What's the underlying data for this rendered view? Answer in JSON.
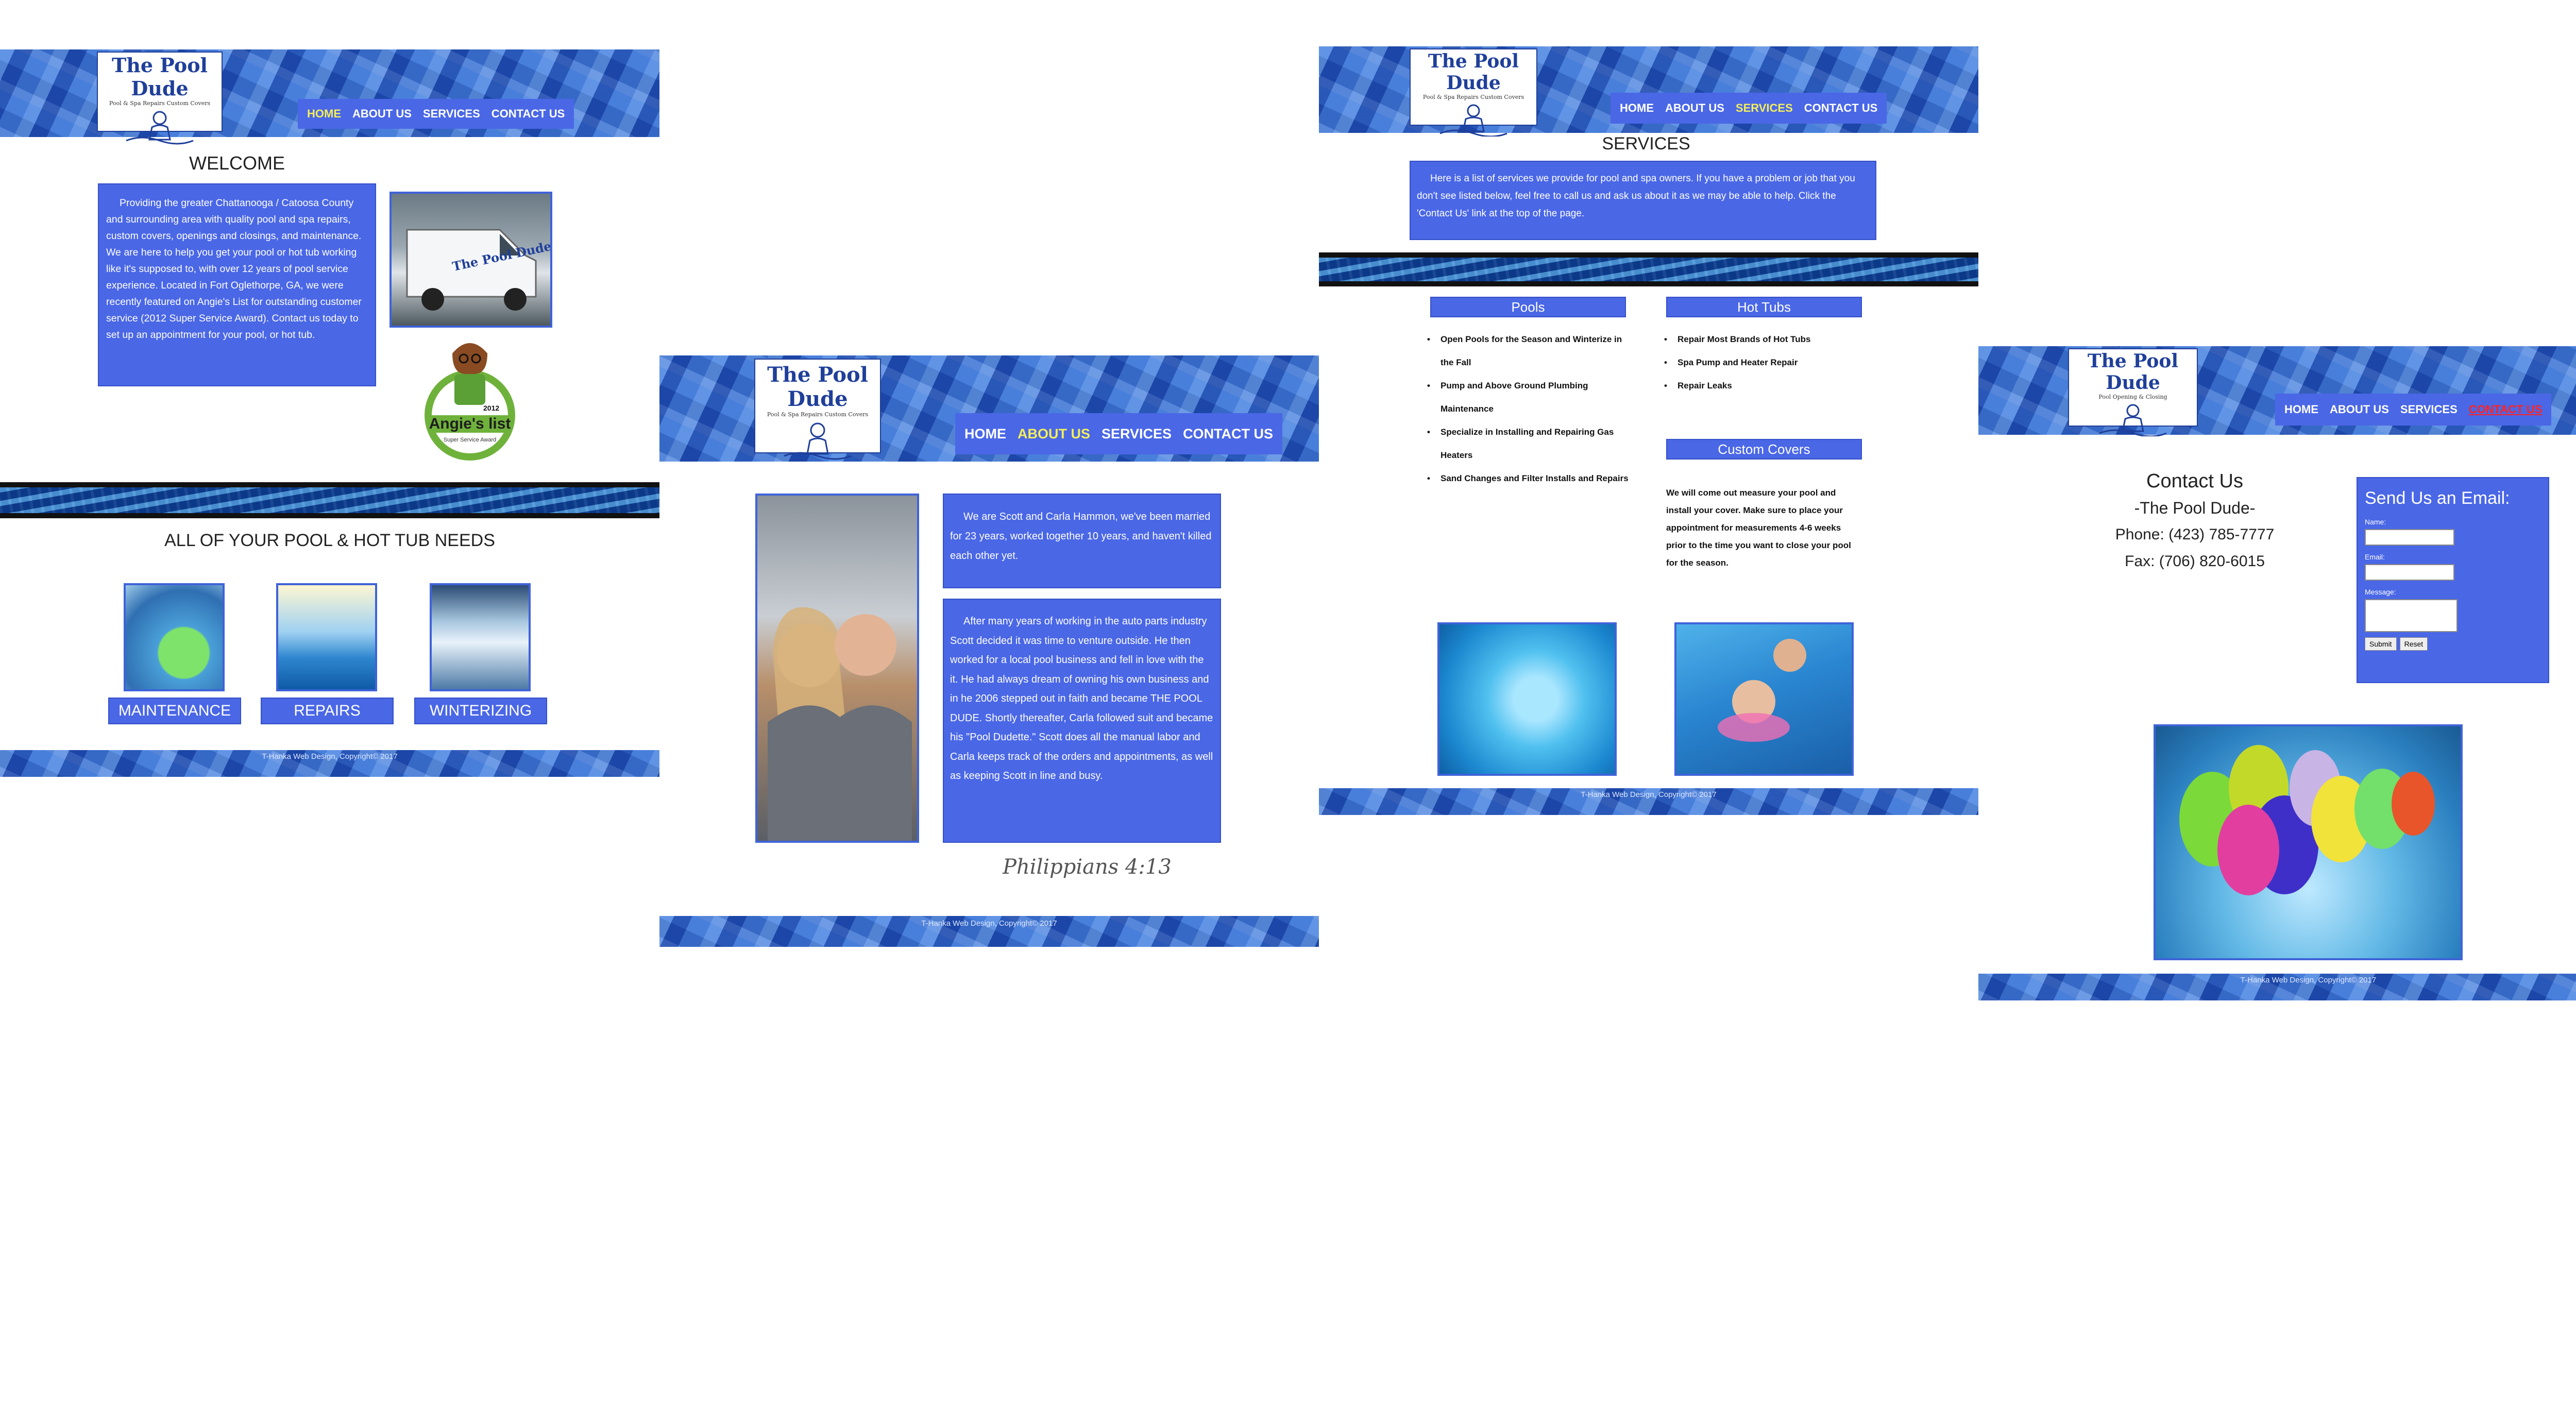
{
  "site": {
    "logo_title": "The Pool Dude",
    "logo_sub_left": "Pool & Spa Repairs Custom Covers",
    "logo_sub_right": "Pool Opening & Closing",
    "footer_text": "T-Hanka Web Design, Copyright© 2017",
    "nav": [
      "HOME",
      "ABOUT US",
      "SERVICES",
      "CONTACT US"
    ]
  },
  "home": {
    "welcome_heading": "WELCOME",
    "intro_text": "Providing the greater Chattanooga / Catoosa County and surrounding area with quality pool and spa repairs, custom covers, openings and closings, and maintenance. We are here to help you get your pool or hot tub working like it's supposed to, with over 12 years of pool service experience. Located in Fort Oglethorpe, GA, we were recently featured on Angie's List for outstanding customer service (2012 Super Service Award). Contact us today to set up an appointment for your pool, or hot tub.",
    "badge_text": "Angie's list",
    "badge_year": "2012",
    "badge_sub": "Super Service Award",
    "needs_heading": "ALL OF YOUR POOL & HOT TUB NEEDS",
    "tiles": [
      "MAINTENANCE",
      "REPAIRS",
      "WINTERIZING"
    ]
  },
  "about": {
    "para1": "We are Scott and Carla Hammon, we've been married for 23 years, worked together 10 years, and haven't killed each other yet.",
    "para2": "After many years of working in the auto parts industry Scott decided it was time to venture outside. He then worked for a local pool business and fell in love with the it. He had always dream of owning his own business and in he 2006 stepped out in faith and became THE POOL DUDE. Shortly thereafter, Carla followed suit and became his \"Pool Dudette.\" Scott does all the manual labor and Carla keeps track of the orders and appointments, as well as keeping Scott in line and busy.",
    "verse": "Philippians 4:13"
  },
  "services": {
    "heading": "SERVICES",
    "intro": "Here is a list of services we provide for pool and spa owners. If you have a problem or job that you don't see listed below, feel free to call us and ask us about it as we may be able to help. Click the 'Contact Us' link at the top of the page.",
    "pools_title": "Pools",
    "pools_items": [
      "Open Pools for the Season and Winterize in the Fall",
      "Pump and Above Ground Plumbing Maintenance",
      "Specialize in Installing and Repairing Gas Heaters",
      "Sand Changes and Filter Installs and Repairs"
    ],
    "hottubs_title": "Hot Tubs",
    "hottubs_items": [
      "Repair Most Brands of Hot Tubs",
      "Spa Pump and Heater Repair",
      "Repair Leaks"
    ],
    "covers_title": "Custom Covers",
    "covers_text": "We will come out measure your pool and install your cover. Make sure to place your appointment for measurements 4-6 weeks prior to the time you want to close your pool for the season."
  },
  "contact": {
    "title": "Contact Us",
    "name": "-The Pool Dude-",
    "phone": "Phone: (423) 785-7777",
    "fax": "Fax: (706) 820-6015",
    "form_title": "Send Us an Email:",
    "name_label": "Name:",
    "email_label": "Email:",
    "message_label": "Message:",
    "submit_label": "Submit",
    "reset_label": "Reset"
  },
  "colors": {
    "nav_blue": "#4a67e6",
    "active_yellow": "#f3ee5a",
    "active_red": "#ff2323"
  }
}
